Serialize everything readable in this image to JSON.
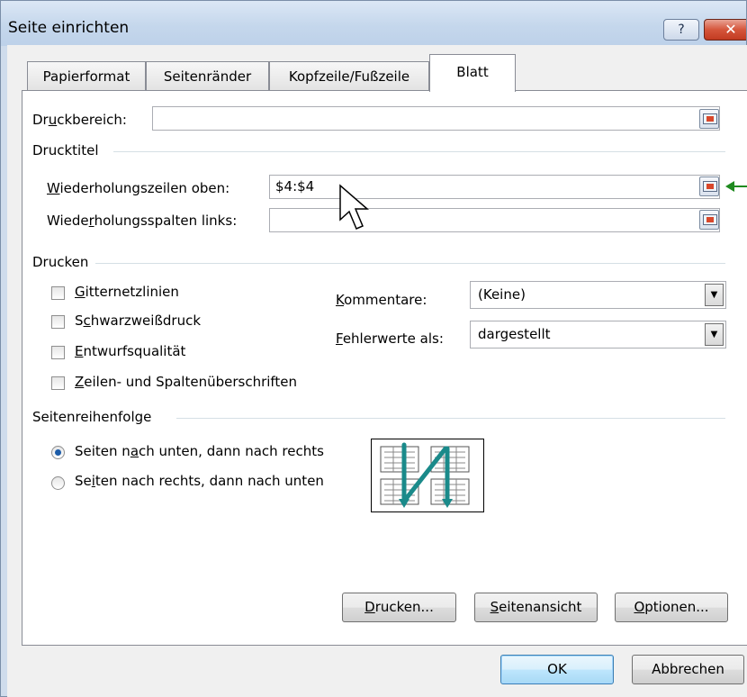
{
  "window": {
    "title": "Seite einrichten",
    "help_label": "?",
    "close_label": "✕"
  },
  "tabs": [
    {
      "label": "Papierformat"
    },
    {
      "label": "Seitenränder"
    },
    {
      "label": "Kopfzeile/Fußzeile"
    },
    {
      "label": "Blatt",
      "active": true
    }
  ],
  "print_area": {
    "label_pre": "Dr",
    "label_u": "u",
    "label_post": "ckbereich:",
    "value": ""
  },
  "print_titles": {
    "group_label": "Drucktitel",
    "rows": {
      "label_u": "W",
      "label_post": "iederholungszeilen oben:",
      "value": "$4:$4"
    },
    "cols": {
      "label_pre": "Wiede",
      "label_u": "r",
      "label_post": "holungsspalten links:",
      "value": ""
    }
  },
  "print": {
    "group_label": "Drucken",
    "checkboxes": [
      {
        "pre": "",
        "u": "G",
        "post": "itternetzlinien",
        "checked": false
      },
      {
        "pre": "S",
        "u": "c",
        "post": "hwarzweißdruck",
        "checked": false
      },
      {
        "pre": "",
        "u": "E",
        "post": "ntwurfsqualität",
        "checked": false
      },
      {
        "pre": "",
        "u": "Z",
        "post": "eilen- und Spaltenüberschriften",
        "checked": false
      }
    ],
    "comments": {
      "label_u": "K",
      "label_post": "ommentare:",
      "value": "(Keine)"
    },
    "errors": {
      "label_u": "F",
      "label_post": "ehlerwerte als:",
      "value": "dargestellt"
    }
  },
  "page_order": {
    "group_label": "Seitenreihenfolge",
    "options": [
      {
        "pre": "Seiten n",
        "u": "a",
        "post": "ch unten, dann nach rechts",
        "selected": true
      },
      {
        "pre": "Se",
        "u": "i",
        "post": "ten nach rechts, dann nach unten",
        "selected": false
      }
    ]
  },
  "buttons": {
    "print": {
      "u": "D",
      "post": "rucken..."
    },
    "preview": {
      "u": "S",
      "post": "eitenansicht"
    },
    "options": {
      "u": "O",
      "post": "ptionen..."
    },
    "ok": "OK",
    "cancel": "Abbrechen"
  },
  "colors": {
    "accent_teal": "#1a8a8a",
    "annotation_arrow": "#1f8a1f",
    "selected_radio": "#1c5ca8"
  },
  "icons": {
    "range_picker": "collapse-dialog-icon",
    "cursor": "mouse-pointer-icon"
  }
}
